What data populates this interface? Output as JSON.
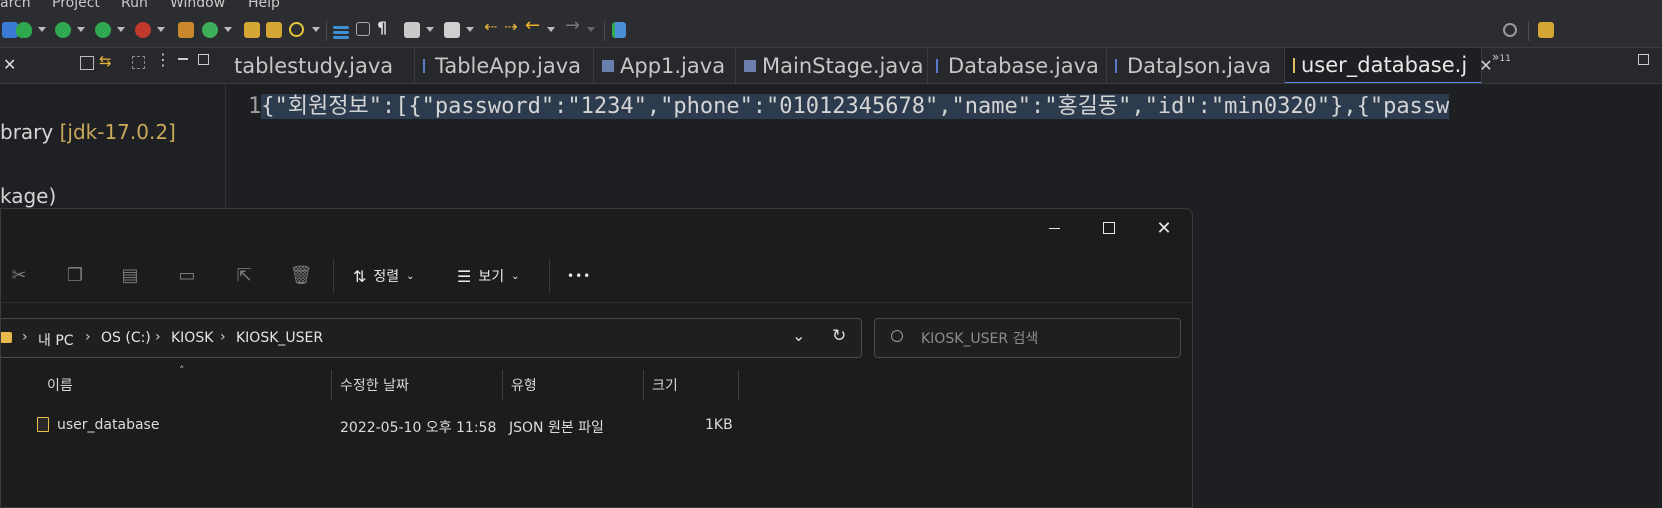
{
  "ide": {
    "menu": [
      "arch",
      "Project",
      "Run",
      "Window",
      "Help"
    ],
    "left_panel": {
      "lines": [
        {
          "text": "brary ",
          "suffix": "[jdk-17.0.2]"
        },
        {
          "text": "kage)",
          "suffix": ""
        }
      ]
    },
    "tabs": [
      {
        "label": "tablestudy.java",
        "icon": "java-file-icon"
      },
      {
        "label": "TableApp.java",
        "icon": "java-file-icon"
      },
      {
        "label": "App1.java",
        "icon": "java-class-icon"
      },
      {
        "label": "MainStage.java",
        "icon": "java-class-icon"
      },
      {
        "label": "Database.java",
        "icon": "java-file-icon"
      },
      {
        "label": "DataJson.java",
        "icon": "java-file-icon"
      },
      {
        "label": "user_database.j",
        "icon": "text-file-icon",
        "active": true
      }
    ],
    "tab_overflow_label": "11",
    "editor": {
      "line_number": "1",
      "code": "{\"회원정보\":[{\"password\":\"1234\",\"phone\":\"01012345678\",\"name\":\"홍길동\",\"id\":\"min0320\"},{\"passw"
    }
  },
  "explorer": {
    "commands": {
      "sort_label": "정렬",
      "view_label": "보기",
      "more_label": "•••"
    },
    "breadcrumb": [
      "내 PC",
      "OS (C:)",
      "KIOSK",
      "KIOSK_USER"
    ],
    "search": {
      "placeholder": "KIOSK_USER 검색"
    },
    "columns": [
      "이름",
      "수정한 날짜",
      "유형",
      "크기"
    ],
    "files": [
      {
        "name": "user_database",
        "modified": "2022-05-10 오후 11:58",
        "type": "JSON 원본 파일",
        "size": "1KB"
      }
    ]
  },
  "colors": {
    "ide_bg": "#1e1f22",
    "explorer_bg": "#1c1c1c",
    "selection": "#2d3b4e",
    "jdk_label": "#c8a85a"
  }
}
